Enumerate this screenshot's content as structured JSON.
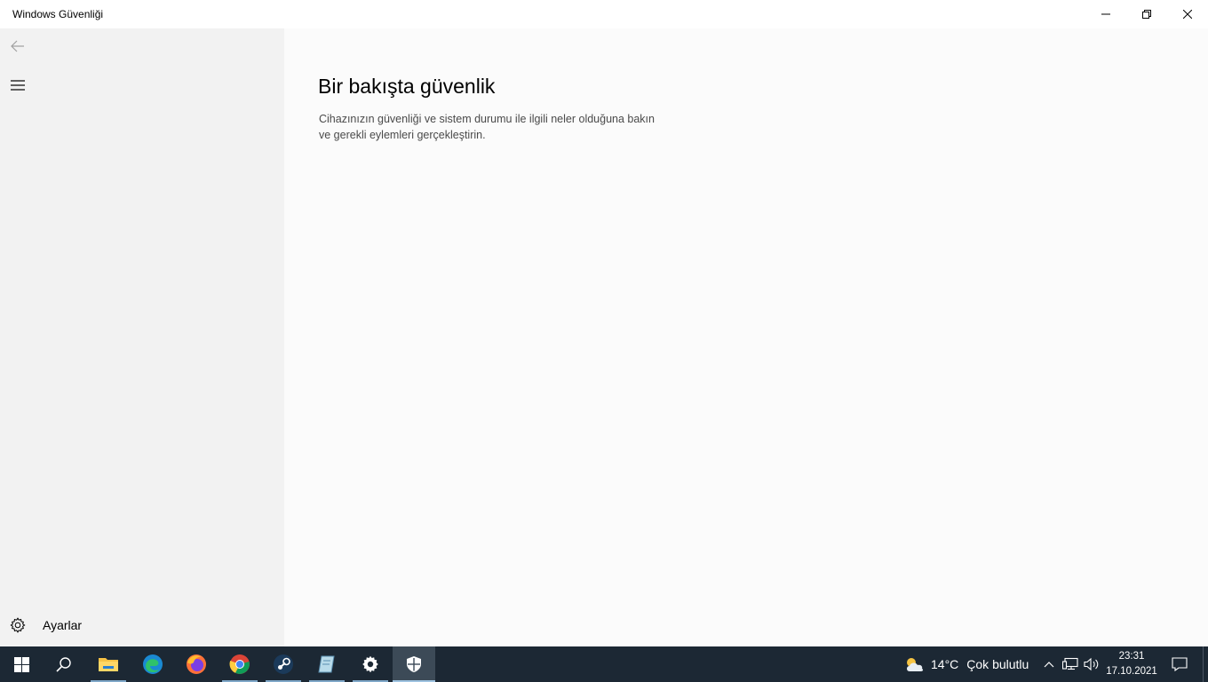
{
  "window": {
    "title": "Windows Güvenliği"
  },
  "sidebar": {
    "settings_label": "Ayarlar"
  },
  "main": {
    "title": "Bir bakışta güvenlik",
    "description": "Cihazınızın güvenliği ve sistem durumu ile ilgili neler olduğuna bakın ve gerekli eylemleri gerçekleştirin."
  },
  "taskbar": {
    "weather_temp": "14°C",
    "weather_text": "Çok bulutlu",
    "time": "23:31",
    "date": "17.10.2021",
    "apps": [
      "start-icon",
      "search-icon",
      "file-explorer-icon",
      "edge-icon",
      "firefox-icon",
      "chrome-icon",
      "steam-icon",
      "notepad-icon",
      "settings-icon",
      "windows-security-icon"
    ]
  },
  "colors": {
    "sidebar_bg": "#f2f2f2",
    "main_bg": "#fbfbfb",
    "taskbar_bg": "#1c2834",
    "active_task_bg": "#3c4a57"
  }
}
